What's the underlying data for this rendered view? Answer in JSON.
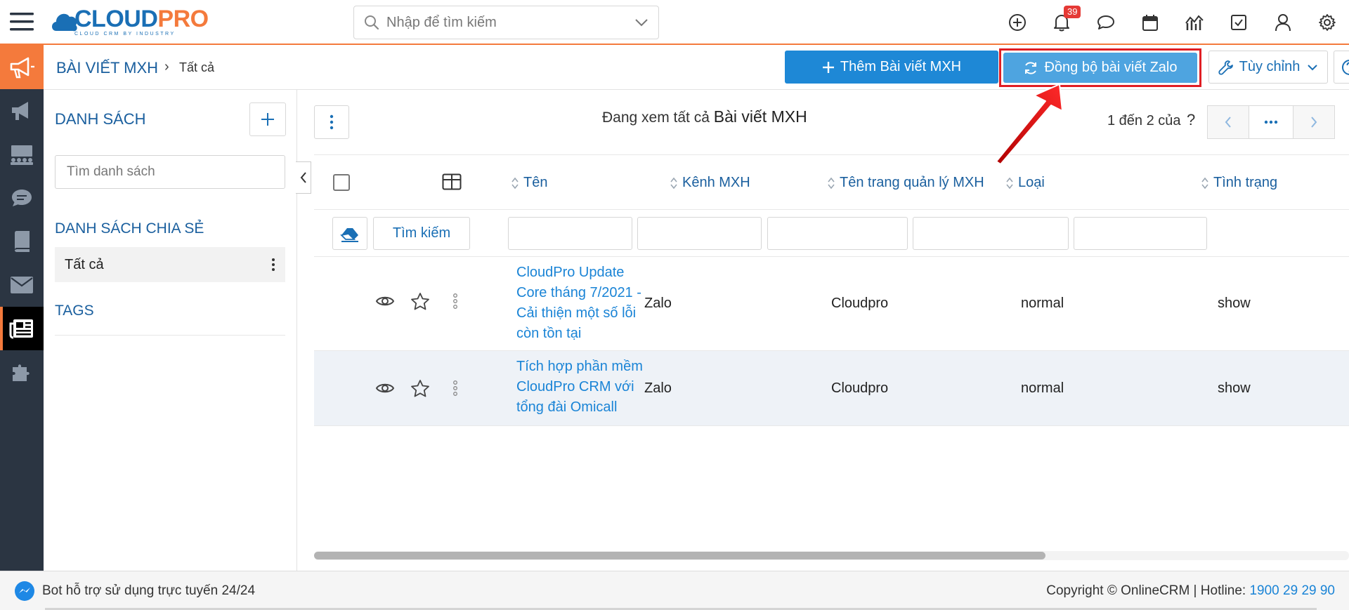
{
  "app": {
    "logo_main": "CLOUD",
    "logo_accent": "PRO",
    "logo_tagline": "CLOUD CRM BY INDUSTRY"
  },
  "header": {
    "search_placeholder": "Nhập để tìm kiếm",
    "notification_count": "39"
  },
  "breadcrumb": {
    "module": "BÀI VIẾT MXH",
    "separator": "›",
    "current": "Tất cả"
  },
  "toolbar": {
    "add_label": "Thêm Bài viết MXH",
    "sync_label": "Đồng bộ bài viết Zalo",
    "customize_label": "Tùy chỉnh"
  },
  "sidebar_list": {
    "title": "DANH SÁCH",
    "search_placeholder": "Tìm danh sách",
    "shared_title": "DANH SÁCH CHIA SẺ",
    "items": [
      {
        "label": "Tất cả"
      }
    ],
    "tags_title": "TAGS"
  },
  "list_view": {
    "viewing_prefix": "Đang xem tất cả",
    "viewing_module": "Bài viết MXH",
    "pager_text": "1 đến 2 của",
    "pager_question": "?",
    "search_button": "Tìm kiếm",
    "columns": [
      "Tên",
      "Kênh MXH",
      "Tên trang quản lý MXH",
      "Loại",
      "Tình trạng"
    ],
    "rows": [
      {
        "name": "CloudPro Update Core tháng 7/2021 - Cải thiện một số lỗi còn tồn tại",
        "channel": "Zalo",
        "page": "Cloudpro",
        "type": "normal",
        "status": "show"
      },
      {
        "name": "Tích hợp phần mềm CloudPro CRM với tổng đài Omicall",
        "channel": "Zalo",
        "page": "Cloudpro",
        "type": "normal",
        "status": "show"
      }
    ]
  },
  "footer": {
    "chat_text": "Bot hỗ trợ sử dụng trực tuyến 24/24",
    "copyright": "Copyright © OnlineCRM | Hotline: ",
    "hotline": "1900 29 29 90"
  },
  "colors": {
    "accent_orange": "#f47a3c",
    "primary_blue": "#1e88d6",
    "sidebar_dark": "#2b3542",
    "annotation_red": "#e01e24"
  }
}
